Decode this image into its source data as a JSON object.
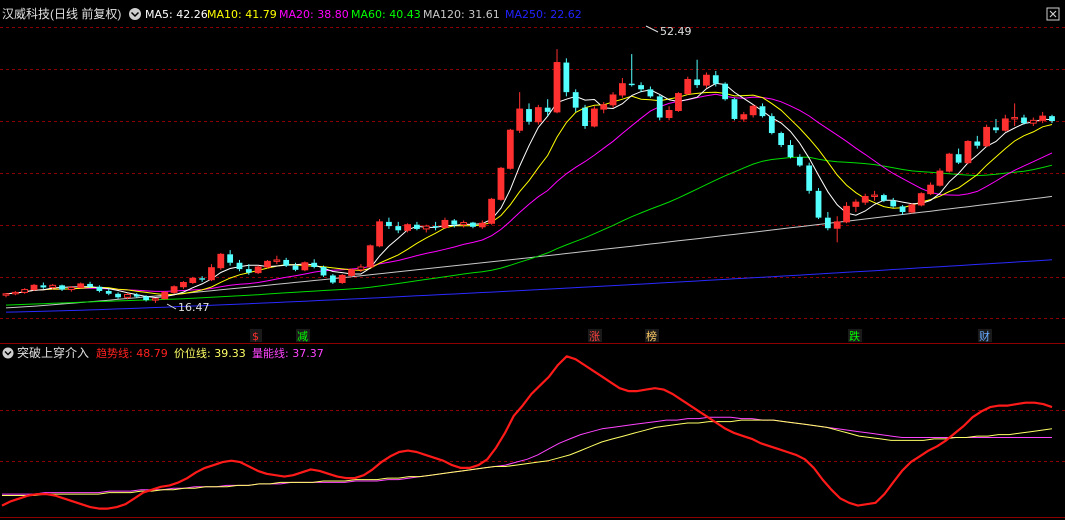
{
  "top_panel": {
    "title": "汉威科技(日线 前复权)",
    "ma_legend": [
      {
        "label": "MA5: 42.26",
        "color": "#ffffff"
      },
      {
        "label": "MA10: 41.79",
        "color": "#ffff00"
      },
      {
        "label": "MA20: 38.80",
        "color": "#ff00ff"
      },
      {
        "label": "MA60: 40.43",
        "color": "#00ff00"
      },
      {
        "label": "MA120: 31.61",
        "color": "#c8c8c8"
      },
      {
        "label": "MA250: 22.62",
        "color": "#2222ff"
      }
    ],
    "high_label": "52.49",
    "low_label": "16.47",
    "event_markers": [
      {
        "text": "$",
        "color": "#ff3030"
      },
      {
        "text": "减",
        "color": "#00ff00"
      },
      {
        "text": "涨",
        "color": "#ff4040"
      },
      {
        "text": "榜",
        "color": "#ffcc66"
      },
      {
        "text": "跌",
        "color": "#00ff00"
      },
      {
        "text": "财",
        "color": "#66aaff"
      }
    ]
  },
  "bottom_panel": {
    "title": "突破上穿介入",
    "indicators": [
      {
        "label": "趋势线: 48.79",
        "color": "#ff2020"
      },
      {
        "label": "价位线: 39.33",
        "color": "#ffff66"
      },
      {
        "label": "量能线: 37.37",
        "color": "#ff44ff"
      }
    ]
  },
  "colors": {
    "up": "#ff3030",
    "down": "#54ffff",
    "grid": "#8b0000",
    "background": "#000000"
  },
  "chart_data": {
    "type": "line",
    "candles": [
      [
        17.6,
        17.9,
        17.3,
        17.8
      ],
      [
        17.8,
        18.2,
        17.6,
        18.0
      ],
      [
        18.0,
        18.6,
        17.8,
        18.4
      ],
      [
        18.4,
        19.2,
        18.2,
        19.0
      ],
      [
        19.0,
        19.4,
        18.5,
        18.7
      ],
      [
        18.7,
        19.2,
        18.4,
        19.0
      ],
      [
        19.0,
        19.1,
        18.2,
        18.4
      ],
      [
        18.4,
        18.9,
        18.1,
        18.7
      ],
      [
        18.7,
        19.4,
        18.6,
        19.2
      ],
      [
        19.2,
        19.5,
        18.6,
        18.8
      ],
      [
        18.8,
        19.0,
        18.0,
        18.2
      ],
      [
        18.2,
        18.5,
        17.6,
        17.8
      ],
      [
        17.8,
        18.0,
        17.1,
        17.3
      ],
      [
        17.3,
        17.9,
        17.0,
        17.7
      ],
      [
        17.7,
        17.9,
        17.2,
        17.4
      ],
      [
        17.4,
        17.6,
        16.7,
        16.9
      ],
      [
        16.9,
        17.2,
        16.5,
        17.1
      ],
      [
        17.1,
        18.2,
        17.0,
        18.0
      ],
      [
        18.0,
        19.0,
        17.8,
        18.8
      ],
      [
        18.8,
        19.6,
        18.5,
        19.4
      ],
      [
        19.4,
        20.2,
        19.2,
        20.0
      ],
      [
        20.0,
        20.3,
        19.5,
        19.8
      ],
      [
        19.8,
        22.0,
        19.6,
        21.5
      ],
      [
        21.5,
        23.6,
        21.2,
        23.4
      ],
      [
        23.4,
        24.0,
        21.8,
        22.2
      ],
      [
        22.2,
        22.6,
        21.0,
        21.3
      ],
      [
        21.3,
        22.0,
        20.5,
        20.8
      ],
      [
        20.8,
        21.8,
        20.6,
        21.6
      ],
      [
        21.6,
        22.6,
        21.4,
        22.4
      ],
      [
        22.4,
        23.2,
        22.0,
        22.6
      ],
      [
        22.6,
        22.9,
        21.6,
        21.8
      ],
      [
        21.8,
        22.2,
        21.0,
        21.2
      ],
      [
        21.2,
        22.4,
        21.0,
        22.2
      ],
      [
        22.2,
        22.7,
        21.4,
        21.6
      ],
      [
        21.6,
        21.8,
        20.2,
        20.4
      ],
      [
        20.4,
        20.6,
        19.2,
        19.4
      ],
      [
        19.4,
        20.6,
        19.2,
        20.4
      ],
      [
        20.4,
        21.4,
        20.2,
        21.2
      ],
      [
        21.2,
        22.0,
        20.9,
        21.6
      ],
      [
        21.6,
        24.8,
        21.5,
        24.6
      ],
      [
        24.6,
        28.4,
        24.4,
        28.0
      ],
      [
        28.0,
        28.6,
        27.0,
        27.4
      ],
      [
        27.4,
        28.0,
        26.4,
        26.8
      ],
      [
        26.8,
        27.8,
        26.5,
        27.6
      ],
      [
        27.6,
        28.0,
        26.8,
        27.0
      ],
      [
        27.0,
        27.6,
        26.5,
        27.4
      ],
      [
        27.4,
        28.0,
        26.8,
        27.2
      ],
      [
        27.2,
        28.6,
        27.0,
        28.2
      ],
      [
        28.2,
        28.4,
        27.2,
        27.6
      ],
      [
        27.6,
        28.2,
        27.2,
        27.9
      ],
      [
        27.9,
        28.0,
        27.1,
        27.3
      ],
      [
        27.3,
        28.2,
        27.0,
        27.8
      ],
      [
        27.8,
        31.4,
        27.6,
        31.2
      ],
      [
        31.2,
        35.8,
        31.0,
        35.6
      ],
      [
        35.6,
        41.2,
        35.4,
        41.0
      ],
      [
        41.0,
        46.4,
        40.6,
        44.0
      ],
      [
        44.0,
        44.8,
        41.8,
        42.2
      ],
      [
        42.2,
        44.6,
        41.8,
        44.2
      ],
      [
        44.2,
        45.4,
        43.0,
        43.6
      ],
      [
        43.6,
        52.5,
        43.4,
        50.6
      ],
      [
        50.6,
        51.2,
        45.8,
        46.4
      ],
      [
        46.4,
        46.8,
        43.6,
        44.2
      ],
      [
        44.2,
        44.6,
        41.2,
        41.6
      ],
      [
        41.6,
        44.4,
        41.4,
        44.0
      ],
      [
        44.0,
        45.0,
        43.4,
        44.6
      ],
      [
        44.6,
        46.4,
        44.2,
        46.0
      ],
      [
        46.0,
        48.4,
        45.6,
        47.6
      ],
      [
        47.6,
        51.8,
        47.2,
        47.4
      ],
      [
        47.4,
        47.8,
        46.4,
        46.8
      ],
      [
        46.8,
        47.2,
        45.6,
        45.8
      ],
      [
        45.8,
        46.0,
        42.4,
        42.8
      ],
      [
        42.8,
        44.4,
        42.4,
        43.8
      ],
      [
        43.8,
        46.4,
        43.6,
        46.2
      ],
      [
        46.2,
        48.6,
        46.0,
        48.2
      ],
      [
        48.2,
        51.0,
        47.0,
        47.4
      ],
      [
        47.4,
        49.2,
        47.0,
        48.8
      ],
      [
        48.8,
        49.4,
        47.2,
        47.6
      ],
      [
        47.6,
        47.8,
        45.2,
        45.4
      ],
      [
        45.4,
        45.6,
        42.4,
        42.6
      ],
      [
        42.6,
        43.6,
        42.2,
        43.2
      ],
      [
        43.2,
        44.6,
        42.8,
        44.4
      ],
      [
        44.4,
        44.8,
        42.8,
        43.0
      ],
      [
        43.0,
        43.4,
        40.4,
        40.6
      ],
      [
        40.6,
        40.8,
        38.6,
        38.9
      ],
      [
        38.9,
        39.6,
        37.0,
        37.2
      ],
      [
        37.2,
        37.6,
        35.8,
        36.0
      ],
      [
        36.0,
        36.4,
        32.0,
        32.4
      ],
      [
        32.4,
        32.8,
        28.4,
        28.6
      ],
      [
        28.6,
        29.4,
        26.8,
        27.1
      ],
      [
        27.1,
        28.8,
        25.1,
        28.0
      ],
      [
        28.0,
        30.8,
        27.8,
        30.2
      ],
      [
        30.2,
        31.2,
        29.4,
        30.8
      ],
      [
        30.8,
        32.0,
        30.4,
        31.6
      ],
      [
        31.6,
        32.4,
        31.0,
        31.8
      ],
      [
        31.8,
        32.0,
        30.8,
        31.0
      ],
      [
        31.0,
        31.4,
        30.0,
        30.2
      ],
      [
        30.2,
        30.4,
        29.0,
        29.4
      ],
      [
        29.4,
        30.6,
        29.2,
        30.4
      ],
      [
        30.4,
        32.2,
        30.2,
        32.0
      ],
      [
        32.0,
        33.6,
        31.8,
        33.2
      ],
      [
        33.2,
        35.6,
        33.0,
        35.2
      ],
      [
        35.2,
        37.8,
        35.0,
        37.6
      ],
      [
        37.6,
        38.4,
        36.2,
        36.4
      ],
      [
        36.4,
        39.6,
        36.2,
        39.4
      ],
      [
        39.4,
        40.2,
        38.4,
        38.8
      ],
      [
        38.8,
        41.8,
        38.6,
        41.4
      ],
      [
        41.4,
        42.6,
        40.6,
        41.0
      ],
      [
        41.0,
        43.2,
        40.8,
        42.6
      ],
      [
        42.6,
        44.8,
        41.6,
        42.8
      ],
      [
        42.8,
        43.2,
        41.8,
        42.0
      ],
      [
        42.0,
        42.8,
        41.6,
        42.4
      ],
      [
        42.4,
        43.6,
        42.0,
        43.0
      ],
      [
        43.0,
        43.2,
        42.0,
        42.3
      ]
    ],
    "price_range": [
      15.5,
      55.5
    ],
    "ma_end_values": {
      "MA5": 42.26,
      "MA10": 41.79,
      "MA20": 38.8,
      "MA60": 40.43,
      "MA120": 31.61,
      "MA250": 22.62
    },
    "ma250_start": 15.2,
    "ma120_start": 15.8,
    "ma60_start": 16.2,
    "indicator_range": [
      0,
      100
    ],
    "trend_line": [
      3,
      6,
      8,
      10,
      11,
      11,
      10,
      8,
      6,
      4,
      2,
      1,
      1,
      2,
      4,
      8,
      12,
      14,
      16,
      17,
      19,
      22,
      26,
      29,
      31,
      33,
      34,
      33,
      30,
      27,
      25,
      24,
      23,
      24,
      26,
      28,
      27,
      25,
      23,
      22,
      22,
      24,
      28,
      33,
      37,
      40,
      41,
      40,
      38,
      36,
      34,
      31,
      29,
      29,
      31,
      35,
      43,
      53,
      65,
      72,
      80,
      86,
      92,
      100,
      106,
      104,
      100,
      96,
      92,
      88,
      84,
      82,
      82,
      83,
      84,
      83,
      80,
      76,
      72,
      68,
      64,
      60,
      56,
      53,
      51,
      49,
      46,
      44,
      42,
      40,
      38,
      35,
      29,
      21,
      14,
      8,
      5,
      3,
      4,
      5,
      11,
      19,
      27,
      33,
      37,
      41,
      44,
      48,
      53,
      58,
      64,
      68,
      71,
      72,
      72,
      73,
      74,
      74,
      73,
      71
    ],
    "price_line": [
      10,
      10,
      10,
      10,
      11,
      11,
      11,
      11,
      11,
      11,
      12,
      12,
      12,
      13,
      13,
      14,
      14,
      15,
      15,
      16,
      16,
      16,
      17,
      17,
      18,
      18,
      19,
      19,
      19,
      19,
      20,
      20,
      20,
      21,
      21,
      21,
      22,
      22,
      23,
      23,
      24,
      25,
      26,
      27,
      28,
      29,
      30,
      30,
      31,
      32,
      33,
      34,
      36,
      38,
      41,
      44,
      47,
      49,
      51,
      53,
      55,
      57,
      58,
      59,
      60,
      60,
      61,
      61,
      61,
      62,
      62,
      62,
      62,
      61,
      60,
      59,
      58,
      57,
      55,
      53,
      51,
      50,
      49,
      48,
      48,
      48,
      48,
      49,
      49,
      50,
      50,
      51,
      51,
      52,
      52,
      53,
      54,
      55,
      56
    ],
    "volume_line": [
      11,
      11,
      11,
      11,
      12,
      12,
      12,
      12,
      12,
      12,
      13,
      13,
      13,
      14,
      14,
      14,
      15,
      15,
      16,
      16,
      16,
      17,
      17,
      17,
      18,
      18,
      18,
      19,
      19,
      19,
      19,
      19,
      19,
      20,
      20,
      20,
      21,
      21,
      22,
      23,
      24,
      25,
      26,
      27,
      28,
      29,
      30,
      31,
      33,
      35,
      38,
      42,
      46,
      49,
      52,
      54,
      56,
      57,
      58,
      59,
      60,
      61,
      62,
      62,
      63,
      63,
      64,
      64,
      64,
      63,
      63,
      62,
      62,
      61,
      60,
      59,
      58,
      57,
      56,
      55,
      54,
      53,
      52,
      51,
      50,
      50,
      50,
      50,
      50,
      50,
      50,
      50,
      50,
      50,
      50,
      50,
      50,
      50,
      50
    ]
  }
}
